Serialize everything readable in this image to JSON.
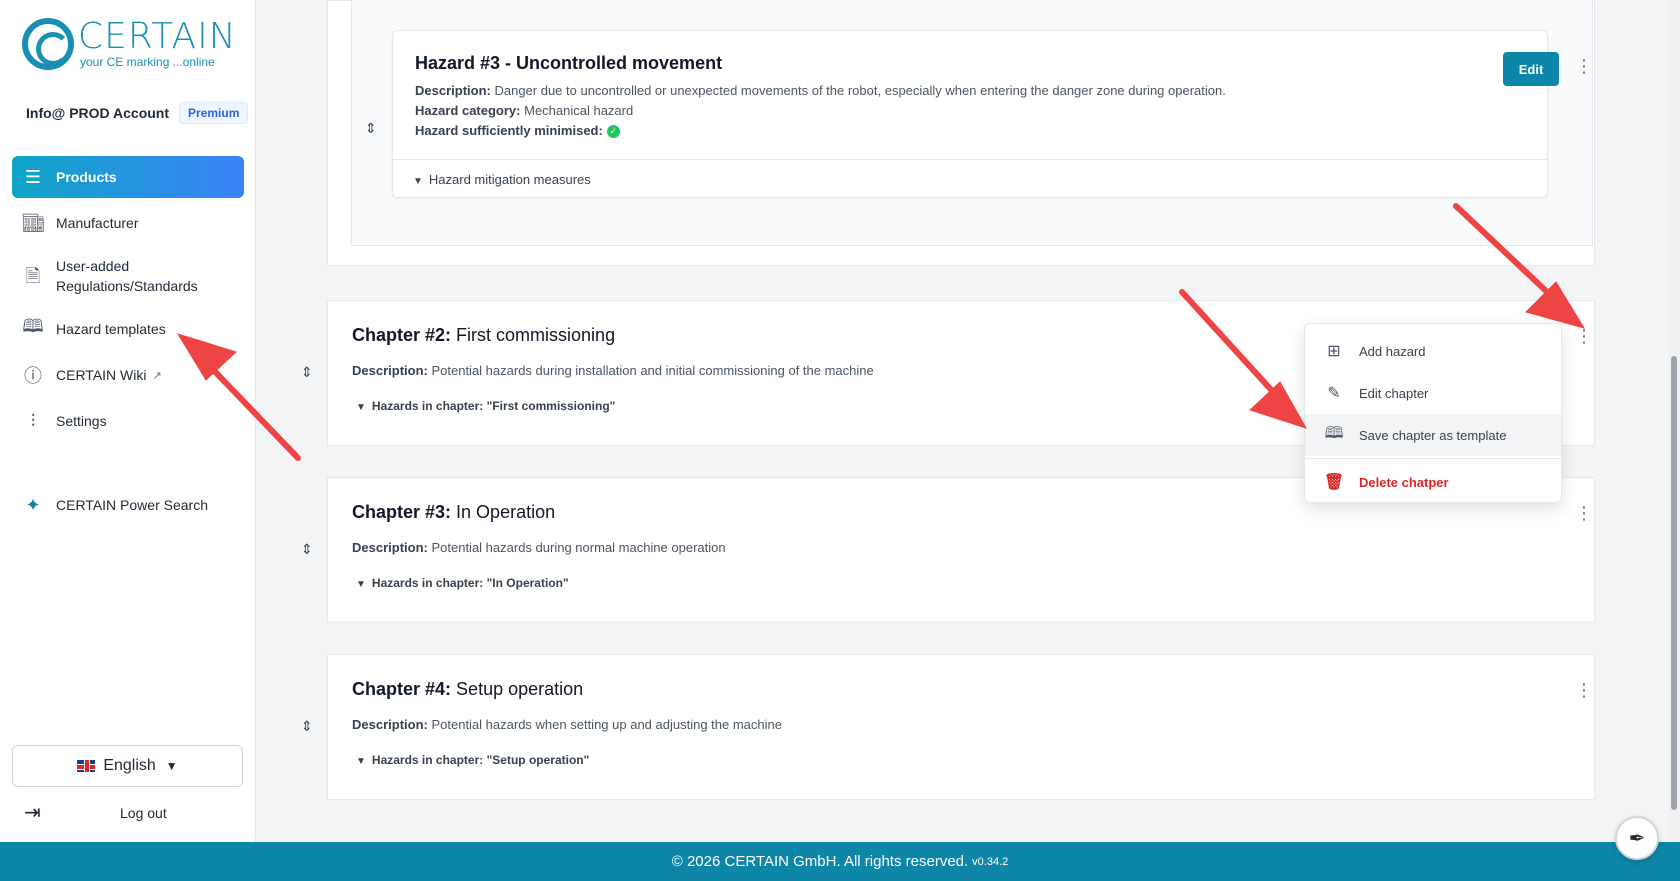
{
  "brand": {
    "name": "CERTAIN",
    "tagline": "your CE marking ...online"
  },
  "account": {
    "name": "Info@ PROD Account",
    "plan": "Premium"
  },
  "sidebar": {
    "items": [
      {
        "label": "Products",
        "icon": "list-icon"
      },
      {
        "label": "Manufacturer",
        "icon": "store-icon"
      },
      {
        "label": "User-added Regulations/Standards",
        "icon": "document-chart-icon"
      },
      {
        "label": "Hazard templates",
        "icon": "book-icon"
      },
      {
        "label": "CERTAIN Wiki",
        "icon": "info-icon"
      },
      {
        "label": "Settings",
        "icon": "sliders-icon"
      },
      {
        "label": "CERTAIN Power Search",
        "icon": "sparkles-icon"
      }
    ],
    "language": "English",
    "logout": "Log out"
  },
  "hazard": {
    "title": "Hazard #3 - Uncontrolled movement",
    "description_label": "Description:",
    "description": "Danger due to uncontrolled or unexpected movements of the robot, especially when entering the danger zone during operation.",
    "category_label": "Hazard category:",
    "category": "Mechanical hazard",
    "minimised_label": "Hazard sufficiently minimised:",
    "mitigation": "Hazard mitigation measures",
    "edit": "Edit"
  },
  "chapters": [
    {
      "prefix": "Chapter #2:",
      "title": "First commissioning",
      "desc_label": "Description:",
      "desc": "Potential hazards during installation and initial commissioning of the machine",
      "hazards": "Hazards in chapter: \"First commissioning\""
    },
    {
      "prefix": "Chapter #3:",
      "title": "In Operation",
      "desc_label": "Description:",
      "desc": "Potential hazards during normal machine operation",
      "hazards": "Hazards in chapter: \"In Operation\""
    },
    {
      "prefix": "Chapter #4:",
      "title": "Setup operation",
      "desc_label": "Description:",
      "desc": "Potential hazards when setting up and adjusting the machine",
      "hazards": "Hazards in chapter: \"Setup operation\""
    }
  ],
  "menu": {
    "add_hazard": "Add hazard",
    "edit_chapter": "Edit chapter",
    "save_template": "Save chapter as template",
    "delete_chapter": "Delete chatper"
  },
  "footer": {
    "text": "© 2026 CERTAIN GmbH. All rights reserved.",
    "version": "v0.34.2"
  },
  "colors": {
    "primary": "#0e86a8",
    "accent": "#3b82f6",
    "danger": "#dc2626",
    "success": "#22c55e",
    "arrow": "#ef4444"
  }
}
